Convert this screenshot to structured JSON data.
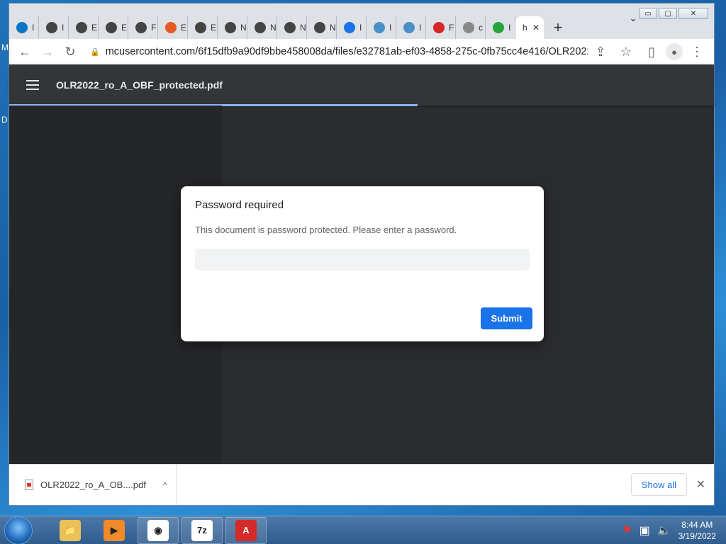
{
  "desktop": {
    "frag1": "M",
    "frag2": "D"
  },
  "window": {
    "controls": {
      "minimize": "▭",
      "maximize": "▢",
      "close": "✕"
    }
  },
  "tabs": [
    {
      "icon": "dell-icon",
      "label": "I",
      "color": "#0a76c4"
    },
    {
      "icon": "chrome-icon",
      "label": "I",
      "color": "#444"
    },
    {
      "icon": "globe-icon",
      "label": "E",
      "color": "#444"
    },
    {
      "icon": "globe-icon",
      "label": "E",
      "color": "#444"
    },
    {
      "icon": "globe-icon",
      "label": "F",
      "color": "#444"
    },
    {
      "icon": "bittorrent-icon",
      "label": "E",
      "color": "#e65a24"
    },
    {
      "icon": "globe-icon",
      "label": "E",
      "color": "#444"
    },
    {
      "icon": "chrome-icon",
      "label": "N",
      "color": "#444"
    },
    {
      "icon": "chrome-icon",
      "label": "N",
      "color": "#444"
    },
    {
      "icon": "globe-icon",
      "label": "N",
      "color": "#444"
    },
    {
      "icon": "chrome-icon",
      "label": "N",
      "color": "#444"
    },
    {
      "icon": "download-icon",
      "label": "I",
      "color": "#1a73e8"
    },
    {
      "icon": "brain-icon",
      "label": "I",
      "color": "#4a90c8"
    },
    {
      "icon": "brain-icon",
      "label": "I",
      "color": "#4a90c8"
    },
    {
      "icon": "question-icon",
      "label": "F",
      "color": "#d62626"
    },
    {
      "icon": "globe-icon",
      "label": "c",
      "color": "#888"
    },
    {
      "icon": "green-download-icon",
      "label": "I",
      "color": "#27a33b"
    }
  ],
  "active_tab": {
    "label": "h",
    "close": "✕"
  },
  "new_tab": "+",
  "tab_menu": "⌄",
  "toolbar": {
    "back": "←",
    "forward": "→",
    "reload": "↻",
    "lock": "🔒",
    "url": "mcusercontent.com/6f15dfb9a90df9bbe458008da/files/e32781ab-ef03-4858-275c-0fb75cc4e416/OLR2022...",
    "share": "⇪",
    "star": "☆",
    "sidepanel": "▯",
    "menu": "⋮"
  },
  "pdf": {
    "title": "OLR2022_ro_A_OBF_protected.pdf"
  },
  "dialog": {
    "title": "Password required",
    "message": "This document is password protected. Please enter a password.",
    "input_value": "",
    "submit_label": "Submit"
  },
  "download_bar": {
    "file_name": "OLR2022_ro_A_OB....pdf",
    "caret": "^",
    "show_all": "Show all",
    "close": "✕"
  },
  "taskbar": {
    "apps": [
      {
        "name": "explorer",
        "glyph": "📁",
        "bg": "#e8c15a"
      },
      {
        "name": "media-player",
        "glyph": "▶",
        "bg": "#f08a2a"
      },
      {
        "name": "chrome",
        "glyph": "◉",
        "bg": "#ffffff"
      },
      {
        "name": "7zip",
        "glyph": "7z",
        "bg": "#ffffff"
      },
      {
        "name": "pdf-app",
        "glyph": "A",
        "bg": "#d42a2a"
      }
    ],
    "time": "8:44 AM",
    "date": "3/19/2022"
  }
}
